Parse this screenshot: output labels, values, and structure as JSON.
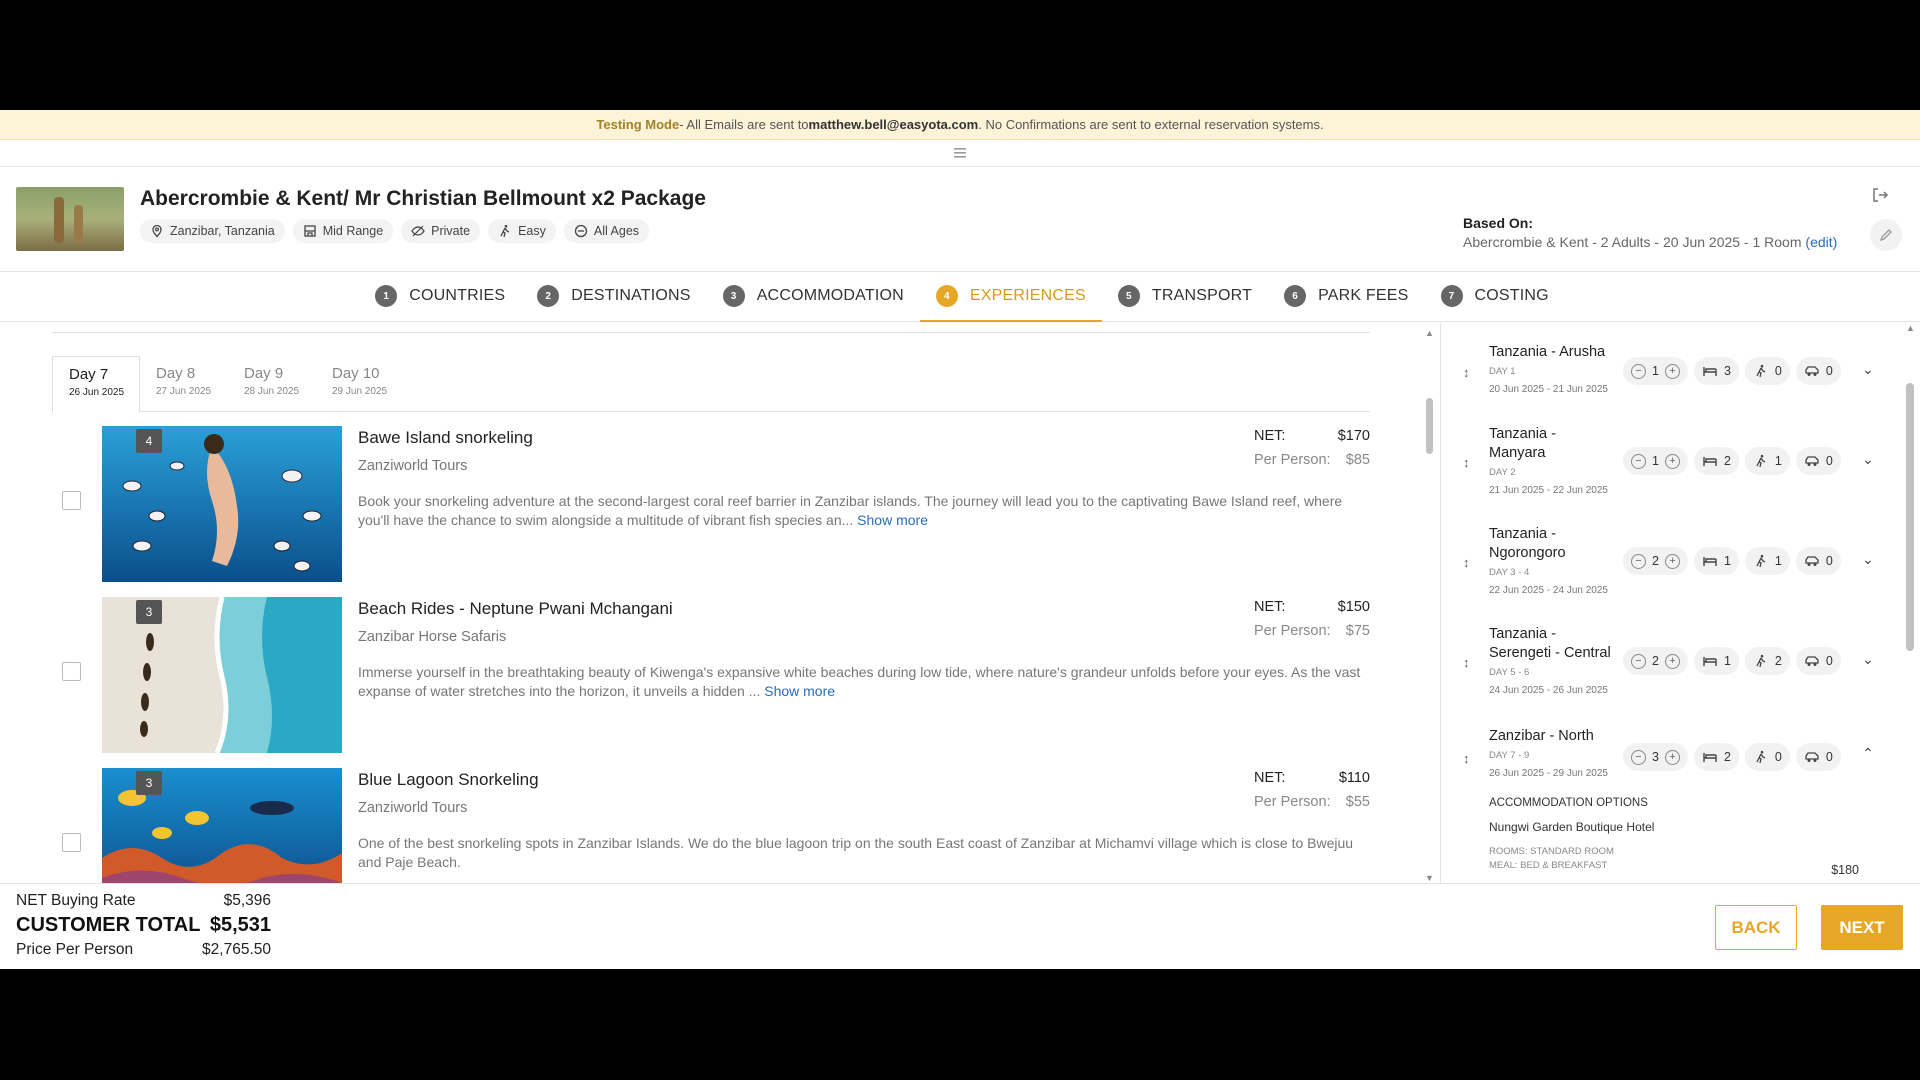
{
  "banner": {
    "label": "Testing Mode",
    "text_before": " - All Emails are sent to ",
    "email": "matthew.bell@easyota.com",
    "text_after": ". No Confirmations are sent to external reservation systems."
  },
  "menu_icon": "hamburger-icon",
  "package": {
    "title": "Abercrombie & Kent/ Mr Christian Bellmount x2 Package",
    "chips": [
      {
        "icon": "location-pin-icon",
        "label": "Zanzibar, Tanzania"
      },
      {
        "icon": "hotel-icon",
        "label": "Mid Range"
      },
      {
        "icon": "eye-off-icon",
        "label": "Private"
      },
      {
        "icon": "hiker-icon",
        "label": "Easy"
      },
      {
        "icon": "age-icon",
        "label": "All Ages"
      }
    ],
    "based_on_label": "Based On:",
    "based_on_value": "Abercrombie & Kent - 2 Adults - 20 Jun 2025 - 1 Room",
    "edit_link": "(edit)"
  },
  "steps": [
    {
      "num": "1",
      "label": "COUNTRIES"
    },
    {
      "num": "2",
      "label": "DESTINATIONS"
    },
    {
      "num": "3",
      "label": "ACCOMMODATION"
    },
    {
      "num": "4",
      "label": "EXPERIENCES",
      "active": true
    },
    {
      "num": "5",
      "label": "TRANSPORT"
    },
    {
      "num": "6",
      "label": "PARK FEES"
    },
    {
      "num": "7",
      "label": "COSTING"
    }
  ],
  "day_tabs": [
    {
      "day": "Day 7",
      "date": "26 Jun 2025"
    },
    {
      "day": "Day 8",
      "date": "27 Jun 2025"
    },
    {
      "day": "Day 9",
      "date": "28 Jun 2025"
    },
    {
      "day": "Day 10",
      "date": "29 Jun 2025"
    }
  ],
  "experiences": [
    {
      "badge": "4",
      "title": "Bawe Island snorkeling",
      "supplier": "Zanziworld Tours",
      "description": "Book your snorkeling adventure at the second-largest coral reef barrier in Zanzibar islands. The journey will lead you to the captivating Bawe Island reef, where you'll have the chance to swim alongside a multitude of vibrant fish species an...",
      "show_more": "Show more",
      "net_label": "NET:",
      "net": "$170",
      "pp_label": "Per Person:",
      "pp": "$85"
    },
    {
      "badge": "3",
      "title": "Beach Rides - Neptune Pwani Mchangani",
      "supplier": "Zanzibar Horse Safaris",
      "description": "Immerse yourself in the breathtaking beauty of Kiwenga's expansive white beaches during low tide, where nature's grandeur unfolds before your eyes. As the vast expanse of water stretches into the horizon, it unveils a hidden ...",
      "show_more": "Show more",
      "net_label": "NET:",
      "net": "$150",
      "pp_label": "Per Person:",
      "pp": "$75"
    },
    {
      "badge": "3",
      "title": "Blue Lagoon Snorkeling",
      "supplier": "Zanziworld Tours",
      "description": "One of the best snorkeling spots in Zanzibar Islands. We do the blue lagoon trip on the south East coast of Zanzibar at Michamvi village which is close to Bwejuu and Paje Beach.",
      "show_more": "",
      "net_label": "NET:",
      "net": "$110",
      "pp_label": "Per Person:",
      "pp": "$55"
    }
  ],
  "destinations": [
    {
      "name": "Tanzania - Arusha",
      "day": "DAY 1",
      "dates": "20 Jun 2025 - 21 Jun 2025",
      "nights": "1",
      "rooms": "3",
      "activities": "0",
      "transport": "0",
      "expanded": false
    },
    {
      "name": "Tanzania - Manyara",
      "day": "DAY 2",
      "dates": "21 Jun 2025 - 22 Jun 2025",
      "nights": "1",
      "rooms": "2",
      "activities": "1",
      "transport": "0",
      "expanded": false
    },
    {
      "name": "Tanzania - Ngorongoro",
      "day": "DAY 3 - 4",
      "dates": "22 Jun 2025 - 24 Jun 2025",
      "nights": "2",
      "rooms": "1",
      "activities": "1",
      "transport": "0",
      "expanded": false
    },
    {
      "name": "Tanzania - Serengeti - Central",
      "day": "DAY 5 - 6",
      "dates": "24 Jun 2025 - 26 Jun 2025",
      "nights": "2",
      "rooms": "1",
      "activities": "2",
      "transport": "0",
      "expanded": false
    },
    {
      "name": "Zanzibar - North",
      "day": "DAY 7 - 9",
      "dates": "26 Jun 2025 - 29 Jun 2025",
      "nights": "3",
      "rooms": "2",
      "activities": "0",
      "transport": "0",
      "expanded": true
    }
  ],
  "accommodation_options": {
    "heading": "ACCOMMODATION OPTIONS",
    "hotel": "Nungwi Garden Boutique Hotel",
    "rooms": "ROOMS: STANDARD ROOM",
    "meal": "MEAL: BED & BREAKFAST",
    "price": "$180"
  },
  "totals": {
    "net_label": "NET Buying Rate",
    "net_value": "$5,396",
    "customer_label": "CUSTOMER TOTAL",
    "customer_value": "$5,531",
    "pp_label": "Price Per Person",
    "pp_value": "$2,765.50"
  },
  "buttons": {
    "back": "BACK",
    "next": "NEXT"
  },
  "colors": {
    "accent": "#e6a726",
    "link": "#2a6db5",
    "banner_bg": "#fdf3d6"
  }
}
